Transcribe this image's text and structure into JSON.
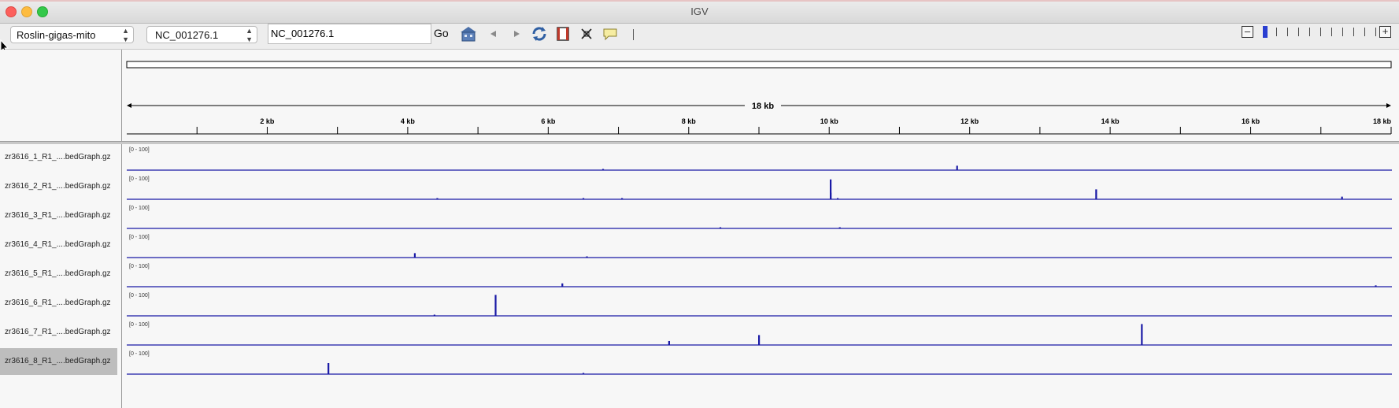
{
  "window": {
    "title": "IGV"
  },
  "toolbar": {
    "genome": "Roslin-gigas-mito",
    "chromosome": "NC_001276.1",
    "locus": "NC_001276.1",
    "go_label": "Go"
  },
  "ruler": {
    "span_label": "18 kb",
    "span_bp": 18000,
    "tick_labels": [
      "2 kb",
      "4 kb",
      "6 kb",
      "8 kb",
      "10 kb",
      "12 kb",
      "14 kb",
      "16 kb",
      "18 kb"
    ]
  },
  "tracks": [
    {
      "name": "zr3616_1_R1_....bedGraph.gz",
      "range": "[0 - 100]",
      "selected": false,
      "peaks": [
        {
          "pos_kb": 6.78,
          "value": 3
        },
        {
          "pos_kb": 11.82,
          "value": 20
        }
      ]
    },
    {
      "name": "zr3616_2_R1_....bedGraph.gz",
      "range": "[0 - 100]",
      "selected": false,
      "peaks": [
        {
          "pos_kb": 4.42,
          "value": 3
        },
        {
          "pos_kb": 6.5,
          "value": 3
        },
        {
          "pos_kb": 7.05,
          "value": 3
        },
        {
          "pos_kb": 10.02,
          "value": 90
        },
        {
          "pos_kb": 10.02,
          "value": 30
        },
        {
          "pos_kb": 10.12,
          "value": 4
        },
        {
          "pos_kb": 13.8,
          "value": 45
        },
        {
          "pos_kb": 17.3,
          "value": 12
        }
      ]
    },
    {
      "name": "zr3616_3_R1_....bedGraph.gz",
      "range": "[0 - 100]",
      "selected": false,
      "peaks": [
        {
          "pos_kb": 8.45,
          "value": 5
        },
        {
          "pos_kb": 10.15,
          "value": 3
        }
      ]
    },
    {
      "name": "zr3616_4_R1_....bedGraph.gz",
      "range": "[0 - 100]",
      "selected": false,
      "peaks": [
        {
          "pos_kb": 4.1,
          "value": 20
        },
        {
          "pos_kb": 6.55,
          "value": 5
        }
      ]
    },
    {
      "name": "zr3616_5_R1_....bedGraph.gz",
      "range": "[0 - 100]",
      "selected": false,
      "peaks": [
        {
          "pos_kb": 6.2,
          "value": 15
        },
        {
          "pos_kb": 17.78,
          "value": 6
        }
      ]
    },
    {
      "name": "zr3616_6_R1_....bedGraph.gz",
      "range": "[0 - 100]",
      "selected": false,
      "peaks": [
        {
          "pos_kb": 4.38,
          "value": 3
        },
        {
          "pos_kb": 5.25,
          "value": 95
        }
      ]
    },
    {
      "name": "zr3616_7_R1_....bedGraph.gz",
      "range": "[0 - 100]",
      "selected": false,
      "peaks": [
        {
          "pos_kb": 7.72,
          "value": 18
        },
        {
          "pos_kb": 9.0,
          "value": 45
        },
        {
          "pos_kb": 14.45,
          "value": 95
        }
      ]
    },
    {
      "name": "zr3616_8_R1_....bedGraph.gz",
      "range": "[0 - 100]",
      "selected": true,
      "peaks": [
        {
          "pos_kb": 2.87,
          "value": 50
        },
        {
          "pos_kb": 6.5,
          "value": 4
        }
      ]
    }
  ],
  "icons": [
    "home-icon",
    "back-icon",
    "forward-icon",
    "refresh-icon",
    "region-of-interest-icon",
    "resize-icon",
    "popup-text-icon",
    "zoom-out-icon",
    "zoom-in-icon"
  ],
  "colors": {
    "track": "#1a1aa6",
    "ruler": "#000000",
    "selected_track": "#bdbdbd"
  },
  "zoom": {
    "level_index": 0,
    "levels": 11
  }
}
